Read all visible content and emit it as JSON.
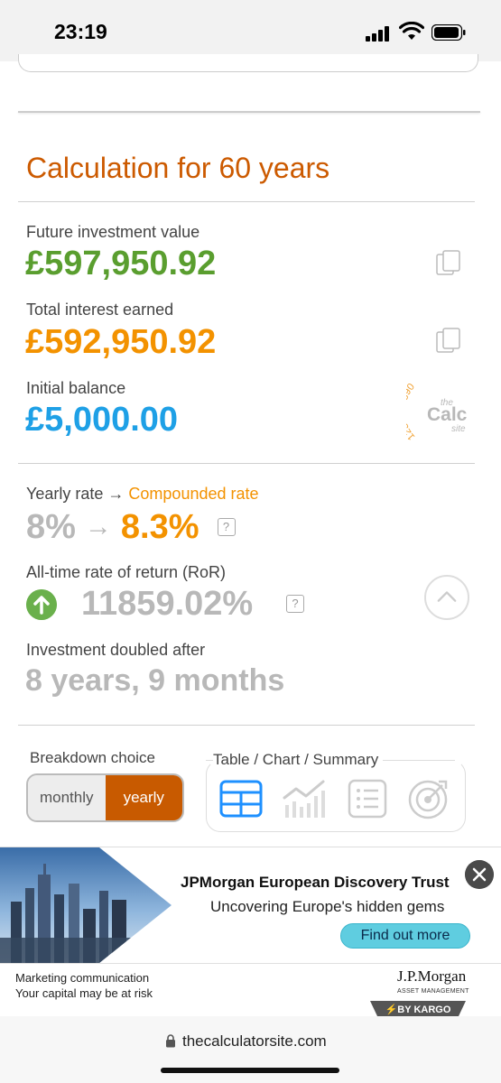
{
  "status_bar": {
    "time": "23:19"
  },
  "calculation": {
    "title": "Calculation for 60 years",
    "future_value_label": "Future investment value",
    "future_value": "£597,950.92",
    "interest_label": "Total interest earned",
    "interest_value": "£592,950.92",
    "initial_label": "Initial balance",
    "initial_value": "£5,000.00",
    "logo_digits": "1234567890",
    "logo_the": "the",
    "logo_calc": "Calc",
    "logo_site": "site"
  },
  "rates": {
    "label_yearly": "Yearly rate",
    "label_arrow": "→",
    "label_compounded": "Compounded rate",
    "yearly_rate": "8%",
    "arrow": "→",
    "compounded_rate": "8.3%",
    "help": "?",
    "ror_label": "All-time rate of return (RoR)",
    "ror_value": "11859.02%",
    "doubled_label": "Investment doubled after",
    "doubled_value": "8 years, 9 months"
  },
  "breakdown": {
    "label": "Breakdown choice",
    "monthly": "monthly",
    "yearly": "yearly",
    "selected": "yearly",
    "views_label": "Table / Chart / Summary"
  },
  "ad": {
    "title": "JPMorgan European Discovery Trust",
    "subtitle": "Uncovering Europe's hidden gems",
    "cta": "Find out more",
    "footer_line1": "Marketing communication",
    "footer_line2": "Your capital may be at risk",
    "brand": "J.P.Morgan",
    "brand_sub": "ASSET MANAGEMENT",
    "kargo": "⚡BY KARGO"
  },
  "browser": {
    "url": "thecalculatorsite.com"
  },
  "colors": {
    "title": "#cc5a00",
    "future": "#5a9e2f",
    "interest": "#f39200",
    "initial": "#1ea0e6",
    "muted": "#b8b8b8",
    "selected_toggle": "#c85a00",
    "icon_blue": "#1e90ff"
  }
}
